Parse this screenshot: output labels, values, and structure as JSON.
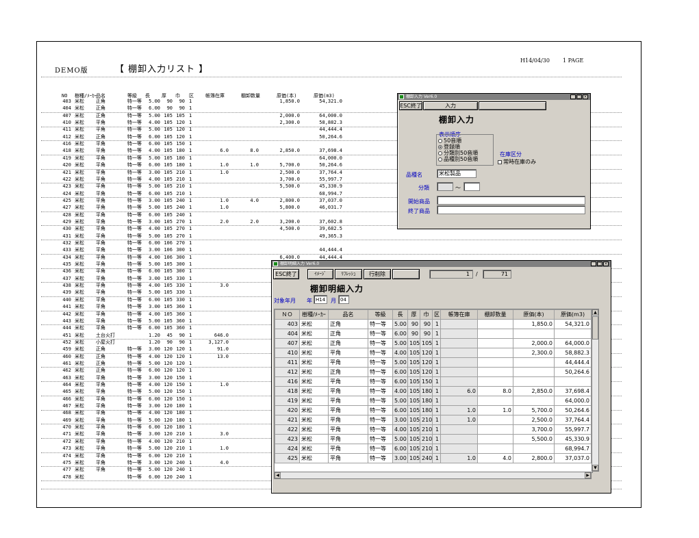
{
  "report": {
    "demo_label": "DEMO版",
    "title": "【 棚卸入力リスト 】",
    "date": "H14/04/30",
    "page": "1 PAGE",
    "headers": [
      "NO",
      "樹種/ﾒｰｶｰ",
      "品名",
      "等級",
      "長",
      "厚",
      "巾",
      "区",
      "帳簿在庫",
      "棚卸数量",
      "原価(本)",
      "原価(m3)"
    ],
    "rows": [
      [
        "403",
        "米松",
        "正角",
        "特一等",
        "5.00",
        "90",
        "90",
        "1",
        "",
        "",
        "1,850.0",
        "54,321.0"
      ],
      [
        "404",
        "米松",
        "正角",
        "特一等",
        "6.00",
        "90",
        "90",
        "1",
        "",
        "",
        "",
        ""
      ],
      [
        "407",
        "米松",
        "正角",
        "特一等",
        "5.00",
        "105",
        "105",
        "1",
        "",
        "",
        "2,000.0",
        "64,000.0"
      ],
      [
        "410",
        "米松",
        "平角",
        "特一等",
        "4.00",
        "105",
        "120",
        "1",
        "",
        "",
        "2,300.0",
        "58,882.3"
      ],
      [
        "411",
        "米松",
        "平角",
        "特一等",
        "5.00",
        "105",
        "120",
        "1",
        "",
        "",
        "",
        "44,444.4"
      ],
      [
        "412",
        "米松",
        "正角",
        "特一等",
        "6.00",
        "105",
        "120",
        "1",
        "",
        "",
        "",
        "50,264.6"
      ],
      [
        "416",
        "米松",
        "平角",
        "特一等",
        "6.00",
        "105",
        "150",
        "1",
        "",
        "",
        "",
        ""
      ],
      [
        "418",
        "米松",
        "平角",
        "特一等",
        "4.00",
        "105",
        "180",
        "1",
        "6.0",
        "8.0",
        "2,850.0",
        "37,698.4"
      ],
      [
        "419",
        "米松",
        "平角",
        "特一等",
        "5.00",
        "105",
        "180",
        "1",
        "",
        "",
        "",
        "64,000.0"
      ],
      [
        "420",
        "米松",
        "平角",
        "特一等",
        "6.00",
        "105",
        "180",
        "1",
        "1.0",
        "1.0",
        "5,700.0",
        "50,264.6"
      ],
      [
        "421",
        "米松",
        "平角",
        "特一等",
        "3.00",
        "105",
        "210",
        "1",
        "1.0",
        "",
        "2,500.0",
        "37,764.4"
      ],
      [
        "422",
        "米松",
        "平角",
        "特一等",
        "4.00",
        "105",
        "210",
        "1",
        "",
        "",
        "3,700.0",
        "55,997.7"
      ],
      [
        "423",
        "米松",
        "平角",
        "特一等",
        "5.00",
        "105",
        "210",
        "1",
        "",
        "",
        "5,500.0",
        "45,330.9"
      ],
      [
        "424",
        "米松",
        "平角",
        "特一等",
        "6.00",
        "105",
        "210",
        "1",
        "",
        "",
        "",
        "68,994.7"
      ],
      [
        "425",
        "米松",
        "平角",
        "特一等",
        "3.00",
        "105",
        "240",
        "1",
        "1.0",
        "4.0",
        "2,800.0",
        "37,037.0"
      ],
      [
        "427",
        "米松",
        "平角",
        "特一等",
        "5.00",
        "105",
        "240",
        "1",
        "1.0",
        "",
        "5,800.0",
        "46,031.7"
      ],
      [
        "428",
        "米松",
        "平角",
        "特一等",
        "6.00",
        "105",
        "240",
        "1",
        "",
        "",
        "",
        ""
      ],
      [
        "429",
        "米松",
        "平角",
        "特一等",
        "3.00",
        "105",
        "270",
        "1",
        "2.0",
        "2.0",
        "3,200.0",
        "37,602.8"
      ],
      [
        "430",
        "米松",
        "平角",
        "特一等",
        "4.00",
        "105",
        "270",
        "1",
        "",
        "",
        "4,500.0",
        "39,682.5"
      ],
      [
        "431",
        "米松",
        "平角",
        "特一等",
        "5.00",
        "105",
        "270",
        "1",
        "",
        "",
        "",
        "49,365.3"
      ],
      [
        "432",
        "米松",
        "平角",
        "特一等",
        "6.00",
        "106",
        "270",
        "1",
        "",
        "",
        "",
        ""
      ],
      [
        "433",
        "米松",
        "平角",
        "特一等",
        "3.00",
        "106",
        "300",
        "1",
        "",
        "",
        "",
        "44,444.4"
      ],
      [
        "434",
        "米松",
        "平角",
        "特一等",
        "4.00",
        "106",
        "300",
        "1",
        "",
        "",
        "6,400.0",
        "44,444.4"
      ],
      [
        "435",
        "米松",
        "平角",
        "特一等",
        "5.00",
        "105",
        "300",
        "1",
        "",
        "",
        "",
        ""
      ],
      [
        "436",
        "米松",
        "平角",
        "特一等",
        "6.00",
        "105",
        "300",
        "1",
        "",
        "",
        "",
        ""
      ],
      [
        "437",
        "米松",
        "平角",
        "特一等",
        "3.00",
        "105",
        "330",
        "1",
        "",
        "",
        "",
        ""
      ],
      [
        "438",
        "米松",
        "平角",
        "特一等",
        "4.00",
        "105",
        "330",
        "1",
        "3.0",
        "",
        "",
        ""
      ],
      [
        "439",
        "米松",
        "平角",
        "特一等",
        "5.00",
        "105",
        "330",
        "1",
        "",
        "",
        "",
        ""
      ],
      [
        "440",
        "米松",
        "平角",
        "特一等",
        "6.00",
        "105",
        "330",
        "1",
        "",
        "",
        "",
        ""
      ],
      [
        "441",
        "米松",
        "平角",
        "特一等",
        "3.00",
        "105",
        "360",
        "1",
        "",
        "",
        "",
        ""
      ],
      [
        "442",
        "米松",
        "平角",
        "特一等",
        "4.00",
        "105",
        "360",
        "1",
        "",
        "",
        "",
        ""
      ],
      [
        "443",
        "米松",
        "平角",
        "特一等",
        "5.00",
        "105",
        "360",
        "1",
        "",
        "",
        "",
        ""
      ],
      [
        "444",
        "米松",
        "平角",
        "特一等",
        "6.00",
        "105",
        "360",
        "1",
        "",
        "",
        "",
        ""
      ],
      [
        "451",
        "米松",
        "土台火打",
        "",
        "1.20",
        "45",
        "90",
        "1",
        "646.0",
        "",
        "",
        ""
      ],
      [
        "452",
        "米松",
        "小屋火打",
        "",
        "1.20",
        "90",
        "90",
        "1",
        "3,127.0",
        "",
        "",
        ""
      ],
      [
        "459",
        "米松",
        "正角",
        "特一等",
        "3.00",
        "120",
        "120",
        "1",
        "91.0",
        "",
        "",
        ""
      ],
      [
        "460",
        "米松",
        "正角",
        "特一等",
        "4.00",
        "120",
        "120",
        "1",
        "13.0",
        "",
        "",
        ""
      ],
      [
        "461",
        "米松",
        "正角",
        "特一等",
        "5.00",
        "120",
        "120",
        "1",
        "",
        "",
        "",
        ""
      ],
      [
        "462",
        "米松",
        "正角",
        "特一等",
        "6.00",
        "120",
        "120",
        "1",
        "",
        "",
        "",
        ""
      ],
      [
        "463",
        "米松",
        "平角",
        "特一等",
        "3.00",
        "120",
        "150",
        "1",
        "",
        "",
        "",
        ""
      ],
      [
        "464",
        "米松",
        "平角",
        "特一等",
        "4.00",
        "120",
        "150",
        "1",
        "1.0",
        "",
        "",
        ""
      ],
      [
        "465",
        "米松",
        "平角",
        "特一等",
        "5.00",
        "120",
        "150",
        "1",
        "",
        "",
        "",
        ""
      ],
      [
        "466",
        "米松",
        "平角",
        "特一等",
        "6.00",
        "120",
        "150",
        "1",
        "",
        "",
        "",
        ""
      ],
      [
        "467",
        "米松",
        "平角",
        "特一等",
        "3.00",
        "120",
        "180",
        "1",
        "",
        "",
        "",
        ""
      ],
      [
        "468",
        "米松",
        "平角",
        "特一等",
        "4.00",
        "120",
        "180",
        "1",
        "",
        "",
        "",
        ""
      ],
      [
        "469",
        "米松",
        "平角",
        "特一等",
        "5.00",
        "120",
        "180",
        "1",
        "",
        "",
        "",
        ""
      ],
      [
        "470",
        "米松",
        "平角",
        "特一等",
        "6.00",
        "120",
        "180",
        "1",
        "",
        "",
        "",
        ""
      ],
      [
        "471",
        "米松",
        "平角",
        "特一等",
        "3.00",
        "120",
        "210",
        "1",
        "3.0",
        "",
        "",
        ""
      ],
      [
        "472",
        "米松",
        "平角",
        "特一等",
        "4.00",
        "120",
        "210",
        "1",
        "",
        "",
        "",
        ""
      ],
      [
        "473",
        "米松",
        "平角",
        "特一等",
        "5.00",
        "120",
        "210",
        "1",
        "1.0",
        "",
        "",
        ""
      ],
      [
        "474",
        "米松",
        "平角",
        "特一等",
        "6.00",
        "120",
        "210",
        "1",
        "",
        "",
        "",
        ""
      ],
      [
        "475",
        "米松",
        "平角",
        "特一等",
        "3.00",
        "120",
        "240",
        "1",
        "4.0",
        "",
        "",
        ""
      ],
      [
        "477",
        "米松",
        "平角",
        "特一等",
        "5.00",
        "120",
        "240",
        "1",
        "",
        "",
        "",
        ""
      ],
      [
        "478",
        "米松",
        "",
        "特一等",
        "6.00",
        "120",
        "240",
        "1",
        "",
        "",
        "",
        ""
      ]
    ]
  },
  "dialog1": {
    "title": "棚卸入力 Ver6.0",
    "esc_label": "ESC終了",
    "tab_label": "入力",
    "heading": "棚卸入力",
    "order_group_label": "表示順序",
    "order_options": [
      {
        "label": "50音順",
        "selected": false
      },
      {
        "label": "登録順",
        "selected": true
      },
      {
        "label": "分類別50音順",
        "selected": false
      },
      {
        "label": "品種別50音順",
        "selected": false
      }
    ],
    "stock_label": "在庫区分",
    "stock_checkbox": "常時在庫のみ",
    "kind_label": "品種名",
    "kind_value": "米松製品",
    "class_label": "分類",
    "class_sep": "～",
    "start_label": "開始商品",
    "end_label": "終了商品"
  },
  "dialog2": {
    "title": "棚卸明細入力 Ver6.0",
    "esc_label": "ESC終了",
    "image_label": "ｲﾒｰｼﾞ",
    "refresh_label": "ﾘﾌﾚｯｼｭ",
    "delete_label": "行削除",
    "page_current": "1",
    "page_sep": "/",
    "page_total": "71",
    "heading": "棚卸明細入力",
    "period_label": "対象年月",
    "year_label": "年",
    "year_value": "H14",
    "month_label": "月",
    "month_value": "04",
    "headers": [
      "ＮＯ",
      "樹種/ﾒｰｶｰ",
      "品名",
      "等級",
      "長",
      "厚",
      "巾",
      "区",
      "帳簿在庫",
      "棚卸数量",
      "原価(本)",
      "原価(m3)"
    ],
    "rows": [
      [
        "403",
        "米松",
        "正角",
        "特一等",
        "5.00",
        "90",
        "90",
        "1",
        "",
        "",
        "1,850.0",
        "54,321.0"
      ],
      [
        "404",
        "米松",
        "正角",
        "特一等",
        "6.00",
        "90",
        "90",
        "1",
        "",
        "",
        "",
        ""
      ],
      [
        "407",
        "米松",
        "正角",
        "特一等",
        "5.00",
        "105",
        "105",
        "1",
        "",
        "",
        "2,000.0",
        "64,000.0"
      ],
      [
        "410",
        "米松",
        "平角",
        "特一等",
        "4.00",
        "105",
        "120",
        "1",
        "",
        "",
        "2,300.0",
        "58,882.3"
      ],
      [
        "411",
        "米松",
        "平角",
        "特一等",
        "5.00",
        "105",
        "120",
        "1",
        "",
        "",
        "",
        "44,444.4"
      ],
      [
        "412",
        "米松",
        "正角",
        "特一等",
        "6.00",
        "105",
        "120",
        "1",
        "",
        "",
        "",
        "50,264.6"
      ],
      [
        "416",
        "米松",
        "平角",
        "特一等",
        "6.00",
        "105",
        "150",
        "1",
        "",
        "",
        "",
        ""
      ],
      [
        "418",
        "米松",
        "平角",
        "特一等",
        "4.00",
        "105",
        "180",
        "1",
        "6.0",
        "8.0",
        "2,850.0",
        "37,698.4"
      ],
      [
        "419",
        "米松",
        "平角",
        "特一等",
        "5.00",
        "105",
        "180",
        "1",
        "",
        "",
        "",
        "64,000.0"
      ],
      [
        "420",
        "米松",
        "平角",
        "特一等",
        "6.00",
        "105",
        "180",
        "1",
        "1.0",
        "1.0",
        "5,700.0",
        "50,264.6"
      ],
      [
        "421",
        "米松",
        "平角",
        "特一等",
        "3.00",
        "105",
        "210",
        "1",
        "1.0",
        "",
        "2,500.0",
        "37,764.4"
      ],
      [
        "422",
        "米松",
        "平角",
        "特一等",
        "4.00",
        "105",
        "210",
        "1",
        "",
        "",
        "3,700.0",
        "55,997.7"
      ],
      [
        "423",
        "米松",
        "平角",
        "特一等",
        "5.00",
        "105",
        "210",
        "1",
        "",
        "",
        "5,500.0",
        "45,330.9"
      ],
      [
        "424",
        "米松",
        "平角",
        "特一等",
        "6.00",
        "105",
        "210",
        "1",
        "",
        "",
        "",
        "68,994.7"
      ],
      [
        "425",
        "米松",
        "平角",
        "特一等",
        "3.00",
        "105",
        "240",
        "1",
        "1.0",
        "4.0",
        "2,800.0",
        "37,037.0"
      ]
    ]
  }
}
